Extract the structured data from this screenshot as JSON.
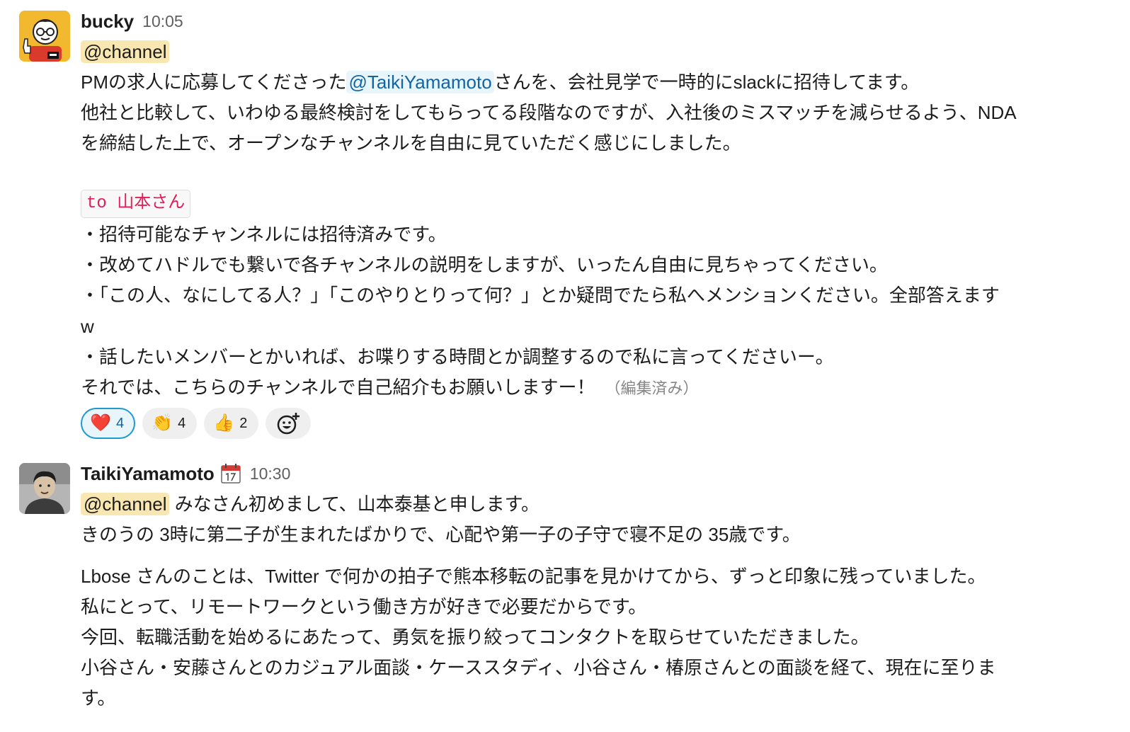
{
  "messages": [
    {
      "author": "bucky",
      "time": "10:05",
      "channel_mention": "@channel",
      "intro_prefix": "PMの求人に応募してくださった",
      "intro_mention": "@TaikiYamamoto",
      "intro_suffix": "さんを、会社見学で一時的にslackに招待してます。",
      "line2": "他社と比較して、いわゆる最終検討をしてもらってる段階なのですが、入社後のミスマッチを減らせるよう、NDA",
      "line3": "を締結した上で、オープンなチャンネルを自由に見ていただく感じにしました。",
      "code": "to 山本さん",
      "bullets": [
        "・招待可能なチャンネルには招待済みです。",
        "・改めてハドルでも繋いで各チャンネルの説明をしますが、いったん自由に見ちゃってください。",
        "・「この人、なにしてる人？」「このやりとりって何？」とか疑問でたら私へメンションください。全部答えます",
        "w",
        "・話したいメンバーとかいれば、お喋りする時間とか調整するので私に言ってくださいー。"
      ],
      "closing": "それでは、こちらのチャンネルで自己紹介もお願いしますー！",
      "edited": "（編集済み）",
      "reactions": [
        {
          "emoji": "❤️",
          "icon": "heart-icon",
          "count": "4",
          "active": true
        },
        {
          "emoji": "👏",
          "icon": "clap-icon",
          "count": "4",
          "active": false
        },
        {
          "emoji": "👍",
          "icon": "thumbs-up-icon",
          "count": "2",
          "active": false
        }
      ],
      "add_reaction_icon": "add-reaction-icon"
    },
    {
      "author": "TaikiYamamoto",
      "status_icon": "calendar-icon",
      "time": "10:30",
      "channel_mention": "@channel",
      "line1_suffix": "みなさん初めまして、山本泰基と申します。",
      "line2": "きのうの 3時に第二子が生まれたばかりで、心配や第一子の子守で寝不足の 35歳です。",
      "para2": [
        "Lbose さんのことは、Twitter で何かの拍子で熊本移転の記事を見かけてから、ずっと印象に残っていました。",
        "私にとって、リモートワークという働き方が好きで必要だからです。",
        "今回、転職活動を始めるにあたって、勇気を振り絞ってコンタクトを取らせていただきました。",
        "小谷さん・安藤さんとのカジュアル面談・ケーススタディ、小谷さん・椿原さんとの面談を経て、現在に至りま",
        "す。"
      ]
    }
  ],
  "colors": {
    "channel_mention_bg": "#f8e7b0",
    "user_mention_bg": "#e8f5fa",
    "user_mention_text": "#1264a3",
    "code_text": "#e01e5a",
    "active_reaction_border": "#1d9bd1"
  }
}
